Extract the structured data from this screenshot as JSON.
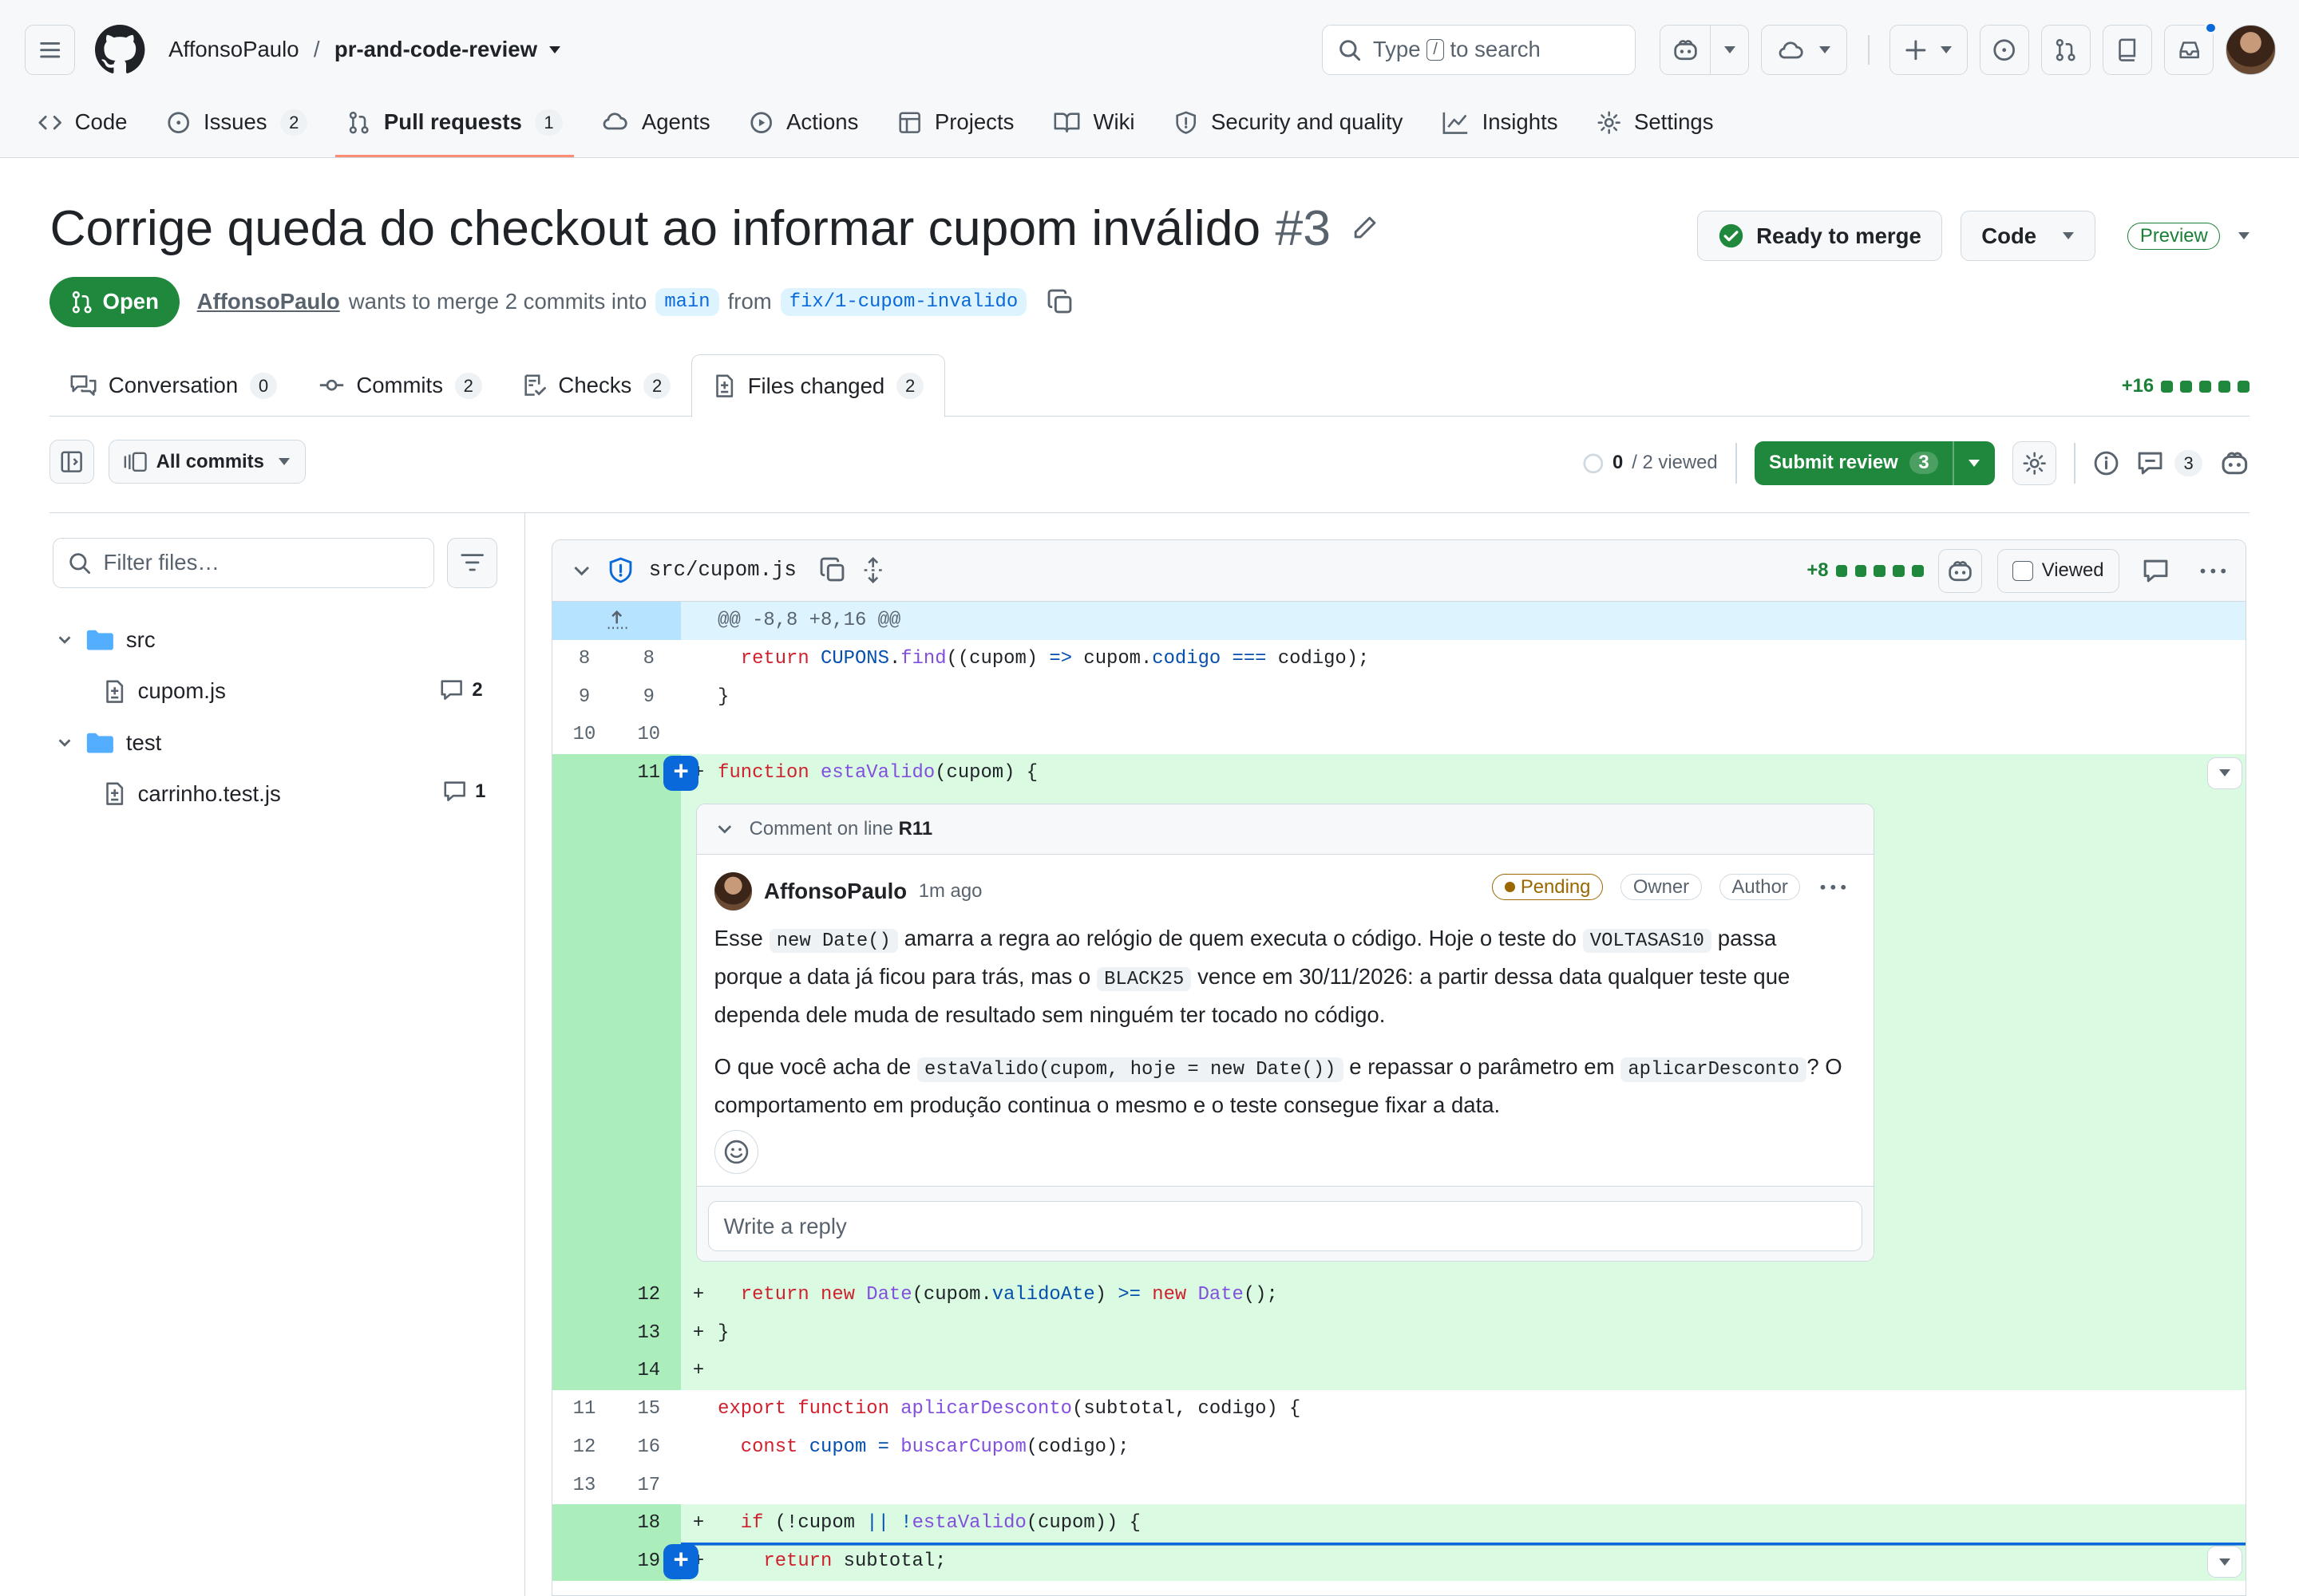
{
  "repo": {
    "owner": "AffonsoPaulo",
    "separator": "/",
    "name": "pr-and-code-review"
  },
  "search": {
    "prefix": "Type",
    "key": "/",
    "suffix": "to search"
  },
  "nav": {
    "tabs": [
      {
        "label": "Code"
      },
      {
        "label": "Issues",
        "count": "2"
      },
      {
        "label": "Pull requests",
        "count": "1"
      },
      {
        "label": "Agents"
      },
      {
        "label": "Actions"
      },
      {
        "label": "Projects"
      },
      {
        "label": "Wiki"
      },
      {
        "label": "Security and quality"
      },
      {
        "label": "Insights"
      },
      {
        "label": "Settings"
      }
    ]
  },
  "pr": {
    "title": "Corrige queda do checkout ao informar cupom inválido",
    "number": "#3",
    "state": "Open",
    "author": "AffonsoPaulo",
    "meta_text": "wants to merge 2 commits into",
    "base_branch": "main",
    "from_text": "from",
    "head_branch": "fix/1-cupom-invalido",
    "ready_label": "Ready to merge",
    "code_label": "Code",
    "preview_label": "Preview"
  },
  "pr_tabs": [
    {
      "label": "Conversation",
      "count": "0"
    },
    {
      "label": "Commits",
      "count": "2"
    },
    {
      "label": "Checks",
      "count": "2"
    },
    {
      "label": "Files changed",
      "count": "2"
    }
  ],
  "diffstat": {
    "additions": "+16"
  },
  "toolbar": {
    "commits_filter": "All commits",
    "viewed_count": "0",
    "viewed_total": "/ 2 viewed",
    "submit_label": "Submit review",
    "submit_count": "3",
    "comments_count": "3"
  },
  "sidebar": {
    "filter_placeholder": "Filter files…",
    "tree": [
      {
        "type": "folder",
        "name": "src"
      },
      {
        "type": "file",
        "name": "cupom.js",
        "comments": "2"
      },
      {
        "type": "folder",
        "name": "test"
      },
      {
        "type": "file",
        "name": "carrinho.test.js",
        "comments": "1"
      }
    ]
  },
  "file": {
    "path": "src/cupom.js",
    "additions": "+8",
    "viewed_label": "Viewed"
  },
  "hunk": "@@ -8,8 +8,16 @@",
  "lines_top": [
    {
      "o": "8",
      "n": "8",
      "code": "  return CUPONS.find((cupom) => cupom.codigo === codigo);"
    },
    {
      "o": "9",
      "n": "9",
      "code": "}"
    },
    {
      "o": "10",
      "n": "10",
      "code": ""
    }
  ],
  "line_11": {
    "n": "11",
    "sign": "+",
    "code": "function estaValido(cupom) {"
  },
  "thread": {
    "header": "Comment on line",
    "line_ref": "R11",
    "author": "AffonsoPaulo",
    "time": "1m ago",
    "badges": {
      "pending": "Pending",
      "owner": "Owner",
      "author": "Author"
    },
    "p1": {
      "t1": "Esse ",
      "c1": "new Date()",
      "t2": " amarra a regra ao relógio de quem executa o código. Hoje o teste do ",
      "c2": "VOLTASAS10",
      "t3": " passa porque a data já ficou para trás, mas o ",
      "c3": "BLACK25",
      "t4": " vence em 30/11/2026: a partir dessa data qualquer teste que dependa dele muda de resultado sem ninguém ter tocado no código."
    },
    "p2": {
      "t1": "O que você acha de ",
      "c1": "estaValido(cupom, hoje = new Date())",
      "t2": " e repassar o parâmetro em ",
      "c2": "aplicarDesconto",
      "t3": "? O comportamento em produção continua o mesmo e o teste consegue fixar a data."
    },
    "reply_placeholder": "Write a reply"
  },
  "lines_mid": [
    {
      "n": "12",
      "sign": "+",
      "code": "  return new Date(cupom.validoAte) >= new Date();"
    },
    {
      "n": "13",
      "sign": "+",
      "code": "}"
    },
    {
      "n": "14",
      "sign": "+",
      "code": ""
    }
  ],
  "lines_ctx": [
    {
      "o": "11",
      "n": "15",
      "code": "export function aplicarDesconto(subtotal, codigo) {"
    },
    {
      "o": "12",
      "n": "16",
      "code": "  const cupom = buscarCupom(codigo);"
    },
    {
      "o": "13",
      "n": "17",
      "code": ""
    }
  ],
  "lines_bottom": [
    {
      "n": "18",
      "sign": "+",
      "code": "  if (!cupom || !estaValido(cupom)) {"
    },
    {
      "n": "19",
      "sign": "+",
      "code": "    return subtotal;"
    }
  ]
}
